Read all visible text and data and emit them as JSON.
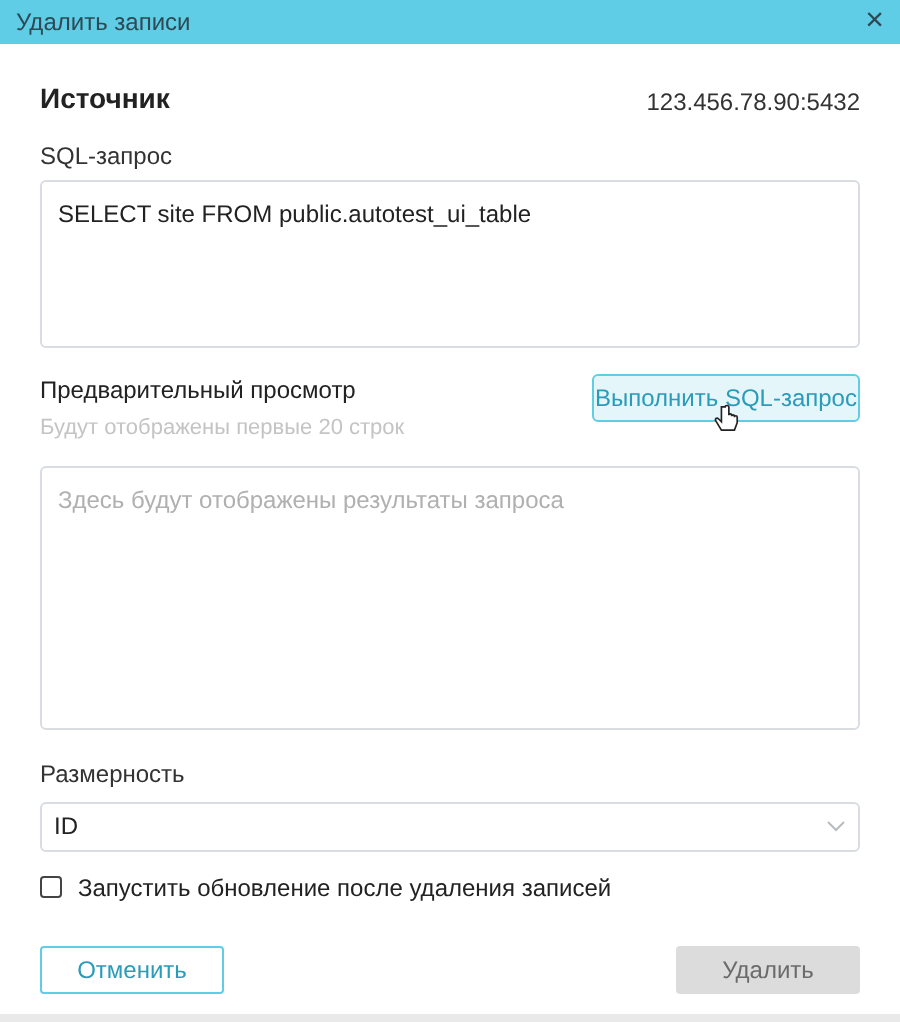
{
  "window": {
    "title": "Удалить записи",
    "close": "×"
  },
  "source": {
    "label": "Источник",
    "address": "123.456.78.90:5432"
  },
  "sql": {
    "label": "SQL-запрос",
    "value": "SELECT site FROM public.autotest_ui_table"
  },
  "preview": {
    "label": "Предварительный просмотр",
    "hint": "Будут отображены первые 20 строк",
    "run_button": "Выполнить SQL-запрос",
    "results_placeholder": "Здесь будут отображены результаты запроса"
  },
  "dimension": {
    "label": "Размерность",
    "value": "ID"
  },
  "refresh_option": {
    "label": "Запустить обновление после удаления записей",
    "checked": false
  },
  "buttons": [
    {
      "label": "Отменить",
      "kind": "secondary",
      "disabled": false
    },
    {
      "label": "Удалить",
      "kind": "primary",
      "disabled": true
    }
  ]
}
